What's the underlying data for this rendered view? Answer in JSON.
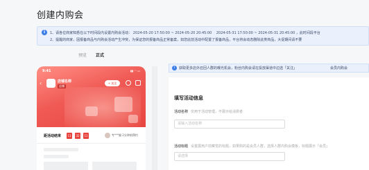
{
  "page": {
    "title": "创建内购会"
  },
  "notice": {
    "line1_prefix": "1、请各位商家知悉在以下时间段内设置内购会活动：",
    "period1": "2024-05-20 17:50:00 ~ 2024-05-20 20:45:00",
    "period2": "2024-05-31 17:50:00 ~ 2024-05-31 20:45:00",
    "line1_suffix": "，此时间段平台",
    "line2": "2、提醒的商家，因报备商品与内购会活动产生冲突，为保证您的报备商品正常备案，如您此前活动中配置了报备商品，平台将会动态删除此类商品，大促期间请不要"
  },
  "preview_toggle": {
    "preview": "预览",
    "official": "正式"
  },
  "phone": {
    "time": "9:41",
    "status": "▮▮ ◠ ▭",
    "shop_name": "店铺名称",
    "shop_tag": "店铺",
    "follow_label": "+ 关注",
    "countdown_label": "距活动结束",
    "cd_hours": "11",
    "cd_minutes": "32",
    "cd_seconds": "11",
    "cd_colon": ":",
    "people_text": "专***猫 2分钟前预约"
  },
  "tip": {
    "text": "获取更多店外召回人群的曝光机会，粉丝内购会请在投放渠道中边选「关注」",
    "text2": "会员内购会"
  },
  "form": {
    "section_title": "填写活动信息",
    "fields": [
      {
        "label": "活动名称",
        "hint": "仅用于活动管理，不展示给消费者",
        "placeholder": "请输入活动名称"
      },
      {
        "label": "活动标题",
        "hint": "设置展用户前察觉的标题，如果购的是会员人群，选择人群内购会模板，标题展示「会员」",
        "placeholder": "请选择"
      }
    ]
  },
  "colors": {
    "accent": "#3b7de9",
    "hero": "#e8453f"
  }
}
